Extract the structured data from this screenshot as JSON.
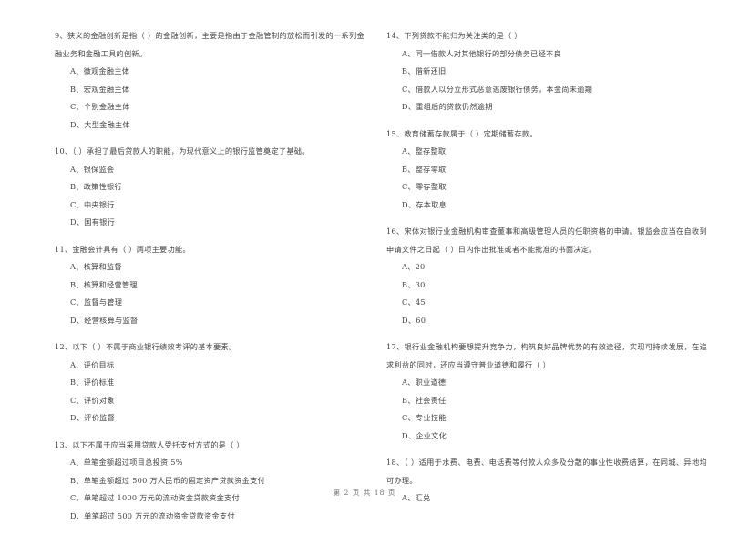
{
  "document": {
    "footer": "第 2 页 共 18 页"
  },
  "left_column": {
    "questions": [
      {
        "stem": "9、狭义的金融创新是指（          ）的金融创新，主要是指由于金融管制的放松而引发的一系列金融业务和金融工具的创新。",
        "options": [
          "A、微观金融主体",
          "B、宏观金融主体",
          "C、个别金融主体",
          "D、大型金融主体"
        ]
      },
      {
        "stem": "10、（         ）承担了最后贷款人的职能，为现代意义上的银行监管奠定了基础。",
        "options": [
          "A、银保监会",
          "B、政策性银行",
          "C、中央银行",
          "D、国有银行"
        ]
      },
      {
        "stem": "11、金融会计具有（       ）两项主要功能。",
        "options": [
          "A、核算和监督",
          "B、核算和经营管理",
          "C、监督与管理",
          "D、经营核算与监督"
        ]
      },
      {
        "stem": "12、以下（       ）不属于商业银行绩效考评的基本要素。",
        "options": [
          "A、评价目标",
          "B、评价标准",
          "C、评价对象",
          "D、评价监督"
        ]
      },
      {
        "stem": "13、以下不属于应当采用贷款人受托支付方式的是（        ）",
        "options": [
          "A、单笔金额超过项目总投资 5%",
          "B、单笔金额超过 500 万人民币的固定资产贷款资金支付",
          "C、单笔超过 1000 万元的流动资金贷款资金支付",
          "D、单笔超过 500 万元的流动资金贷款资金支付"
        ]
      }
    ]
  },
  "right_column": {
    "questions": [
      {
        "stem": "14、下列贷款不能归为关注类的是（        ）",
        "options": [
          "A、同一借款人对其他银行的部分债务已经不良",
          "B、借新还旧",
          "C、借款人以分立形式恶意逃废银行债务，本金尚未逾期",
          "D、重组后的贷款仍然逾期"
        ]
      },
      {
        "stem": "15、教育储蓄存款属于（        ）定期储蓄存款。",
        "options": [
          "A、整存整取",
          "B、整存零取",
          "C、零存整取",
          "D、存本取息"
        ]
      },
      {
        "stem": "16、宋体对银行业金融机构审查董事和高级管理人员的任职资格的申请。银监会应当在自收到申请文件之日起（         ）日内作出批准或者不能批准的书面决定。",
        "options": [
          "A、20",
          "B、30",
          "C、45",
          "D、60"
        ]
      },
      {
        "stem": "17、银行业金融机构要想提升竞争力，构筑良好品牌优势的有效途径，实现可持续发展，在追求利益的同时，还应当遵守普业道德和履行（        ）",
        "options": [
          "A、职业道德",
          "B、社会责任",
          "C、专业技能",
          "D、企业文化"
        ]
      },
      {
        "stem": "18、（        ）适用于水费、电费、电话费等付款人众多及分散的事业性收费结算，在同城、异地均可办理。",
        "options": [
          "A、汇兑"
        ]
      }
    ]
  }
}
